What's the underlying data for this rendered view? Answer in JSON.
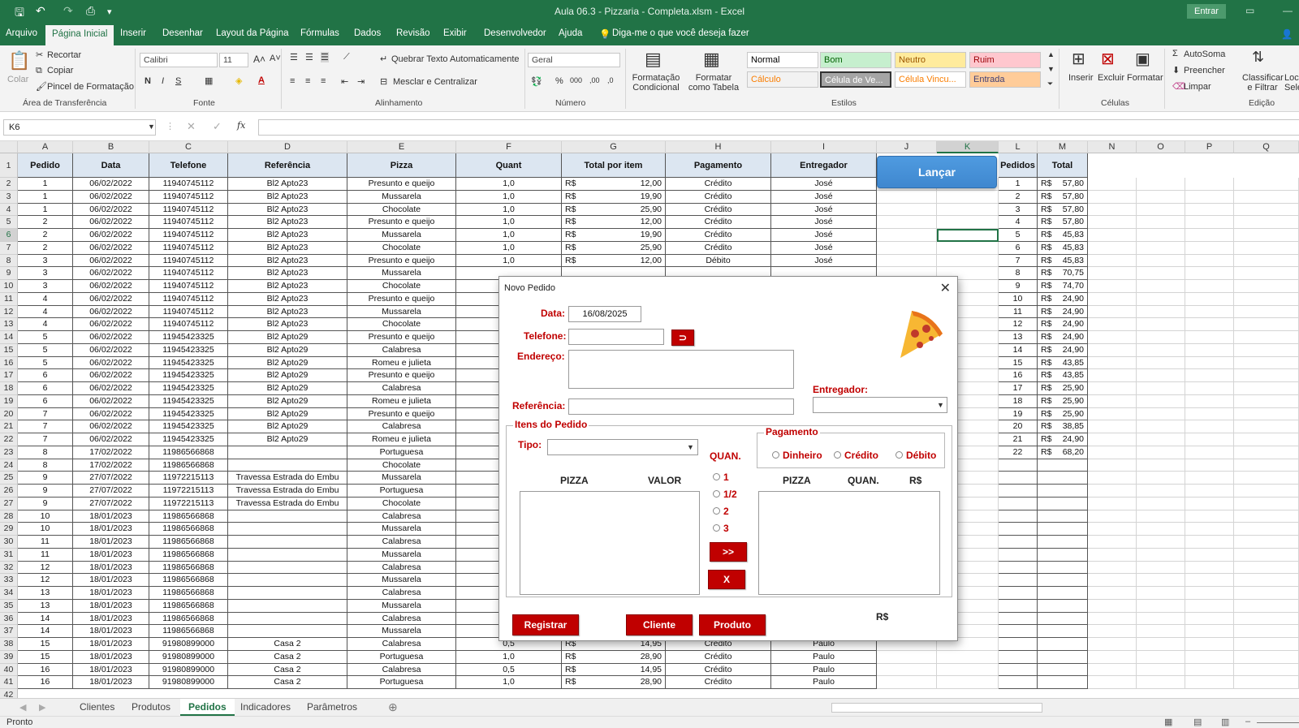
{
  "window": {
    "title": "Aula 06.3 - Pizzaria - Completa.xlsm  -  Excel",
    "login_button": "Entrar"
  },
  "ribbon_tabs": [
    "Arquivo",
    "Página Inicial",
    "Inserir",
    "Desenhar",
    "Layout da Página",
    "Fórmulas",
    "Dados",
    "Revisão",
    "Exibir",
    "Desenvolvedor",
    "Ajuda"
  ],
  "tell_me": "Diga-me o que você deseja fazer",
  "ribbon": {
    "clipboard": {
      "paste": "Colar",
      "cut": "Recortar",
      "copy": "Copiar",
      "format_painter": "Pincel de Formatação",
      "group": "Área de Transferência"
    },
    "font": {
      "family": "Calibri",
      "size": "11",
      "group": "Fonte"
    },
    "alignment": {
      "wrap": "Quebrar Texto Automaticamente",
      "merge": "Mesclar e Centralizar",
      "group": "Alinhamento"
    },
    "number": {
      "format": "Geral",
      "group": "Número"
    },
    "styles": {
      "conditional": "Formatação Condicional",
      "as_table": "Formatar como Tabela",
      "cells": [
        {
          "label": "Normal",
          "bg": "#ffffff",
          "fg": "#000000"
        },
        {
          "label": "Bom",
          "bg": "#c6efce",
          "fg": "#006100"
        },
        {
          "label": "Neutro",
          "bg": "#ffeb9c",
          "fg": "#9c5700"
        },
        {
          "label": "Ruim",
          "bg": "#ffc7ce",
          "fg": "#9c0006"
        },
        {
          "label": "Cálculo",
          "bg": "#f2f2f2",
          "fg": "#fa7d00"
        },
        {
          "label": "Célula de Ve...",
          "bg": "#a5a5a5",
          "fg": "#ffffff"
        },
        {
          "label": "Célula Vincu...",
          "bg": "#ffffff",
          "fg": "#fa7d00"
        },
        {
          "label": "Entrada",
          "bg": "#ffcc99",
          "fg": "#3f3f76"
        }
      ],
      "group": "Estilos"
    },
    "cells_group": {
      "insert": "Inserir",
      "delete": "Excluir",
      "format": "Formatar",
      "group": "Células"
    },
    "editing": {
      "autosum": "AutoSoma",
      "fill": "Preencher",
      "clear": "Limpar",
      "sort": "Classificar e Filtrar",
      "find": "Loc Sele",
      "group": "Edição"
    }
  },
  "formula_bar": {
    "name_box": "K6",
    "fx": "fx"
  },
  "columns": [
    "A",
    "B",
    "C",
    "D",
    "E",
    "F",
    "G",
    "H",
    "I",
    "J",
    "K",
    "L",
    "M",
    "N",
    "O",
    "P",
    "Q"
  ],
  "table_headers": [
    "Pedido",
    "Data",
    "Telefone",
    "Referência",
    "Pizza",
    "Quant",
    "Total por item",
    "Pagamento",
    "Entregador"
  ],
  "rows": [
    [
      "1",
      "06/02/2022",
      "11940745112",
      "Bl2 Apto23",
      "Presunto e queijo",
      "1,0",
      "12,00",
      "Crédito",
      "José"
    ],
    [
      "1",
      "06/02/2022",
      "11940745112",
      "Bl2 Apto23",
      "Mussarela",
      "1,0",
      "19,90",
      "Crédito",
      "José"
    ],
    [
      "1",
      "06/02/2022",
      "11940745112",
      "Bl2 Apto23",
      "Chocolate",
      "1,0",
      "25,90",
      "Crédito",
      "José"
    ],
    [
      "2",
      "06/02/2022",
      "11940745112",
      "Bl2 Apto23",
      "Presunto e queijo",
      "1,0",
      "12,00",
      "Crédito",
      "José"
    ],
    [
      "2",
      "06/02/2022",
      "11940745112",
      "Bl2 Apto23",
      "Mussarela",
      "1,0",
      "19,90",
      "Crédito",
      "José"
    ],
    [
      "2",
      "06/02/2022",
      "11940745112",
      "Bl2 Apto23",
      "Chocolate",
      "1,0",
      "25,90",
      "Crédito",
      "José"
    ],
    [
      "3",
      "06/02/2022",
      "11940745112",
      "Bl2 Apto23",
      "Presunto e queijo",
      "1,0",
      "12,00",
      "Débito",
      "José"
    ],
    [
      "3",
      "06/02/2022",
      "11940745112",
      "Bl2 Apto23",
      "Mussarela",
      "",
      "",
      "",
      ""
    ],
    [
      "3",
      "06/02/2022",
      "11940745112",
      "Bl2 Apto23",
      "Chocolate",
      "",
      "",
      "",
      ""
    ],
    [
      "4",
      "06/02/2022",
      "11940745112",
      "Bl2 Apto23",
      "Presunto e queijo",
      "",
      "",
      "",
      ""
    ],
    [
      "4",
      "06/02/2022",
      "11940745112",
      "Bl2 Apto23",
      "Mussarela",
      "",
      "",
      "",
      ""
    ],
    [
      "4",
      "06/02/2022",
      "11940745112",
      "Bl2 Apto23",
      "Chocolate",
      "",
      "",
      "",
      ""
    ],
    [
      "5",
      "06/02/2022",
      "11945423325",
      "Bl2 Apto29",
      "Presunto e queijo",
      "",
      "",
      "",
      ""
    ],
    [
      "5",
      "06/02/2022",
      "11945423325",
      "Bl2 Apto29",
      "Calabresa",
      "",
      "",
      "",
      ""
    ],
    [
      "5",
      "06/02/2022",
      "11945423325",
      "Bl2 Apto29",
      "Romeu e julieta",
      "",
      "",
      "",
      ""
    ],
    [
      "6",
      "06/02/2022",
      "11945423325",
      "Bl2 Apto29",
      "Presunto e queijo",
      "",
      "",
      "",
      ""
    ],
    [
      "6",
      "06/02/2022",
      "11945423325",
      "Bl2 Apto29",
      "Calabresa",
      "",
      "",
      "",
      ""
    ],
    [
      "6",
      "06/02/2022",
      "11945423325",
      "Bl2 Apto29",
      "Romeu e julieta",
      "",
      "",
      "",
      ""
    ],
    [
      "7",
      "06/02/2022",
      "11945423325",
      "Bl2 Apto29",
      "Presunto e queijo",
      "",
      "",
      "",
      ""
    ],
    [
      "7",
      "06/02/2022",
      "11945423325",
      "Bl2 Apto29",
      "Calabresa",
      "",
      "",
      "",
      ""
    ],
    [
      "7",
      "06/02/2022",
      "11945423325",
      "Bl2 Apto29",
      "Romeu e julieta",
      "",
      "",
      "",
      ""
    ],
    [
      "8",
      "17/02/2022",
      "11986566868",
      "",
      "Portuguesa",
      "",
      "",
      "",
      ""
    ],
    [
      "8",
      "17/02/2022",
      "11986566868",
      "",
      "Chocolate",
      "",
      "",
      "",
      ""
    ],
    [
      "9",
      "27/07/2022",
      "11972215113",
      "Travessa Estrada do Embu",
      "Mussarela",
      "",
      "",
      "",
      ""
    ],
    [
      "9",
      "27/07/2022",
      "11972215113",
      "Travessa Estrada do Embu",
      "Portuguesa",
      "",
      "",
      "",
      ""
    ],
    [
      "9",
      "27/07/2022",
      "11972215113",
      "Travessa Estrada do Embu",
      "Chocolate",
      "",
      "",
      "",
      ""
    ],
    [
      "10",
      "18/01/2023",
      "11986566868",
      "",
      "Calabresa",
      "",
      "",
      "",
      ""
    ],
    [
      "10",
      "18/01/2023",
      "11986566868",
      "",
      "Mussarela",
      "",
      "",
      "",
      ""
    ],
    [
      "11",
      "18/01/2023",
      "11986566868",
      "",
      "Calabresa",
      "",
      "",
      "",
      ""
    ],
    [
      "11",
      "18/01/2023",
      "11986566868",
      "",
      "Mussarela",
      "",
      "",
      "",
      ""
    ],
    [
      "12",
      "18/01/2023",
      "11986566868",
      "",
      "Calabresa",
      "",
      "",
      "",
      ""
    ],
    [
      "12",
      "18/01/2023",
      "11986566868",
      "",
      "Mussarela",
      "",
      "",
      "",
      ""
    ],
    [
      "13",
      "18/01/2023",
      "11986566868",
      "",
      "Calabresa",
      "",
      "",
      "",
      ""
    ],
    [
      "13",
      "18/01/2023",
      "11986566868",
      "",
      "Mussarela",
      "",
      "",
      "",
      ""
    ],
    [
      "14",
      "18/01/2023",
      "11986566868",
      "",
      "Calabresa",
      "",
      "",
      "",
      ""
    ],
    [
      "14",
      "18/01/2023",
      "11986566868",
      "",
      "Mussarela",
      "",
      "",
      "",
      ""
    ],
    [
      "15",
      "18/01/2023",
      "91980899000",
      "Casa 2",
      "Calabresa",
      "0,5",
      "14,95",
      "Crédito",
      "Paulo"
    ],
    [
      "15",
      "18/01/2023",
      "91980899000",
      "Casa 2",
      "Portuguesa",
      "1,0",
      "28,90",
      "Crédito",
      "Paulo"
    ],
    [
      "16",
      "18/01/2023",
      "91980899000",
      "Casa 2",
      "Calabresa",
      "0,5",
      "14,95",
      "Crédito",
      "Paulo"
    ],
    [
      "16",
      "18/01/2023",
      "91980899000",
      "Casa 2",
      "Portuguesa",
      "1,0",
      "28,90",
      "Crédito",
      "Paulo"
    ]
  ],
  "currency": "R$",
  "summary": {
    "headers": [
      "Pedidos",
      "Total"
    ],
    "rows": [
      [
        "1",
        "57,80"
      ],
      [
        "2",
        "57,80"
      ],
      [
        "3",
        "57,80"
      ],
      [
        "4",
        "57,80"
      ],
      [
        "5",
        "45,83"
      ],
      [
        "6",
        "45,83"
      ],
      [
        "7",
        "45,83"
      ],
      [
        "8",
        "70,75"
      ],
      [
        "9",
        "74,70"
      ],
      [
        "10",
        "24,90"
      ],
      [
        "11",
        "24,90"
      ],
      [
        "12",
        "24,90"
      ],
      [
        "13",
        "24,90"
      ],
      [
        "14",
        "24,90"
      ],
      [
        "15",
        "43,85"
      ],
      [
        "16",
        "43,85"
      ],
      [
        "17",
        "25,90"
      ],
      [
        "18",
        "25,90"
      ],
      [
        "19",
        "25,90"
      ],
      [
        "20",
        "38,85"
      ],
      [
        "21",
        "24,90"
      ],
      [
        "22",
        "68,20"
      ]
    ]
  },
  "lancar_button": "Lançar",
  "dialog": {
    "title": "Novo Pedido",
    "data_label": "Data:",
    "data_value": "16/08/2025",
    "telefone_label": "Telefone:",
    "endereco_label": "Endereço:",
    "entregador_label": "Entregador:",
    "referencia_label": "Referência:",
    "itens_legend": "Itens do Pedido",
    "tipo_label": "Tipo:",
    "pagamento_legend": "Pagamento",
    "payment_options": [
      "Dinheiro",
      "Crédito",
      "Débito"
    ],
    "quan_label": "QUAN.",
    "qty_options": [
      "1",
      "1/2",
      "2",
      "3"
    ],
    "left_list_headers": [
      "PIZZA",
      "VALOR"
    ],
    "right_list_headers": [
      "PIZZA",
      "QUAN.",
      "R$"
    ],
    "add_button": ">>",
    "remove_button": "X",
    "registrar_button": "Registrar",
    "cliente_button": "Cliente",
    "produto_button": "Produto",
    "total_label": "R$"
  },
  "sheet_tabs": [
    "Clientes",
    "Produtos",
    "Pedidos",
    "Indicadores",
    "Parâmetros"
  ],
  "active_sheet": "Pedidos",
  "status": "Pronto"
}
